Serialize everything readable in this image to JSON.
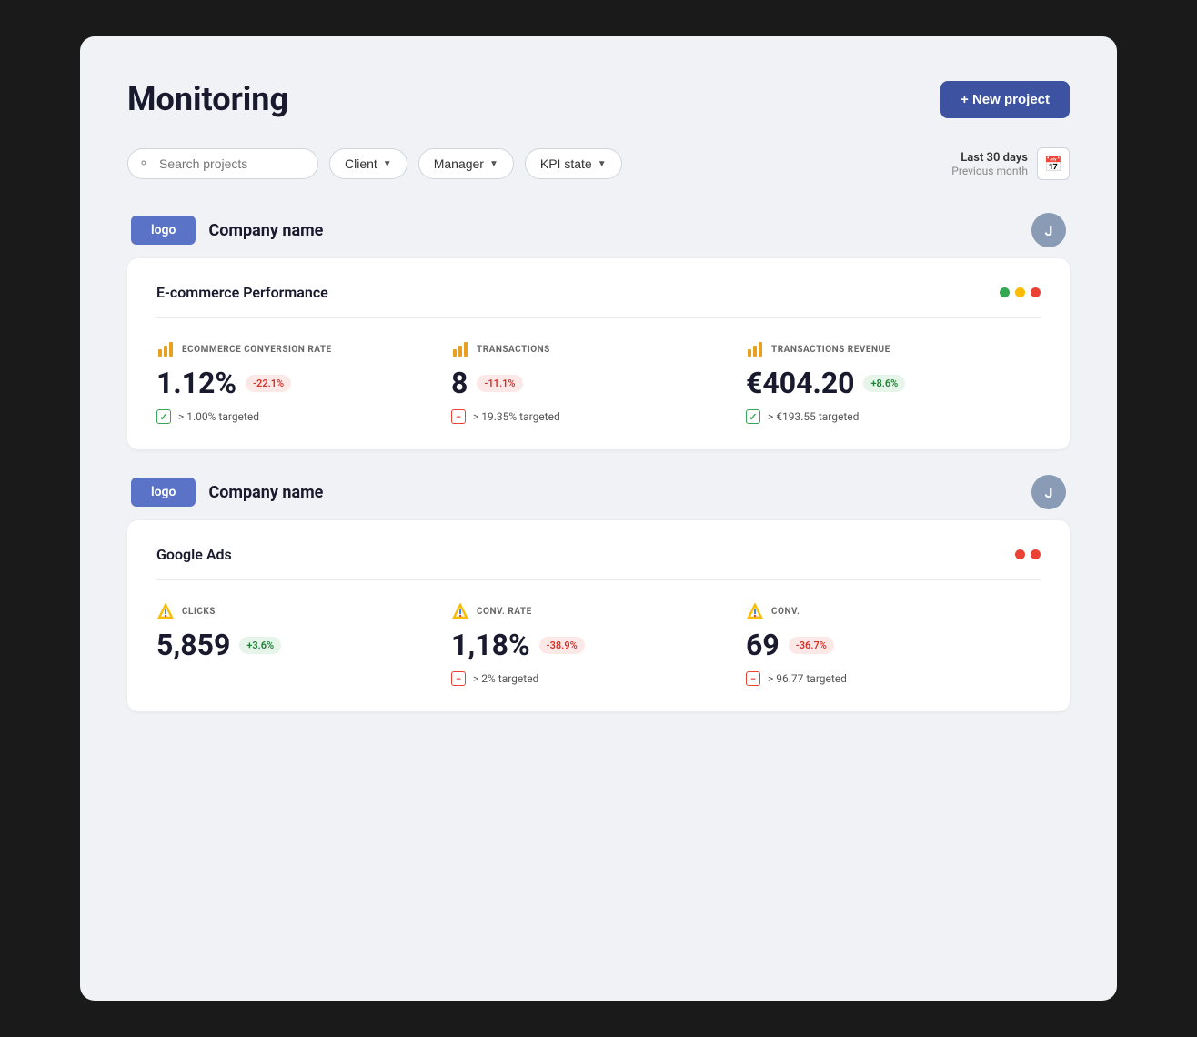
{
  "page": {
    "title": "Monitoring",
    "new_project_btn": "+ New project"
  },
  "filters": {
    "search_placeholder": "Search projects",
    "client_label": "Client",
    "manager_label": "Manager",
    "kpi_state_label": "KPI state",
    "date_last": "Last 30 days",
    "date_prev": "Previous month"
  },
  "companies": [
    {
      "logo": "logo",
      "name": "Company name",
      "avatar": "J",
      "projects": [
        {
          "title": "E-commerce Performance",
          "dots": [
            "green",
            "orange",
            "red"
          ],
          "kpis": [
            {
              "icon_type": "bar",
              "label": "ECOMMERCE CONVERSION RATE",
              "value": "1.12%",
              "badge": "-22.1%",
              "badge_type": "red",
              "target_icon_type": "green",
              "target_text": "> 1.00% targeted"
            },
            {
              "icon_type": "bar",
              "label": "TRANSACTIONS",
              "value": "8",
              "badge": "-11.1%",
              "badge_type": "red",
              "target_icon_type": "red",
              "target_text": "> 19.35% targeted"
            },
            {
              "icon_type": "bar",
              "label": "TRANSACTIONS REVENUE",
              "value": "€404.20",
              "badge": "+8.6%",
              "badge_type": "green",
              "target_icon_type": "green",
              "target_text": "> €193.55 targeted"
            }
          ]
        }
      ]
    },
    {
      "logo": "logo",
      "name": "Company name",
      "avatar": "J",
      "projects": [
        {
          "title": "Google Ads",
          "dots": [
            "red",
            "red"
          ],
          "kpis": [
            {
              "icon_type": "ga",
              "label": "CLICKS",
              "value": "5,859",
              "badge": "+3.6%",
              "badge_type": "green",
              "target_icon_type": null,
              "target_text": null
            },
            {
              "icon_type": "ga",
              "label": "CONV. RATE",
              "value": "1,18%",
              "badge": "-38.9%",
              "badge_type": "red",
              "target_icon_type": "red",
              "target_text": "> 2% targeted"
            },
            {
              "icon_type": "ga",
              "label": "CONV.",
              "value": "69",
              "badge": "-36.7%",
              "badge_type": "red",
              "target_icon_type": "red",
              "target_text": "> 96.77 targeted"
            }
          ]
        }
      ]
    }
  ]
}
